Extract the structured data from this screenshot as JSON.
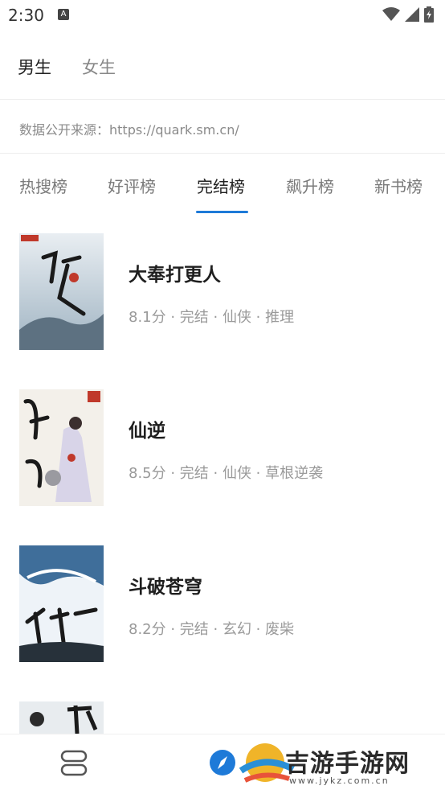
{
  "status": {
    "time": "2:30",
    "notif": "A"
  },
  "gender_tabs": [
    {
      "label": "男生",
      "active": true
    },
    {
      "label": "女生",
      "active": false
    }
  ],
  "source_text": "数据公开来源：https://quark.sm.cn/",
  "rank_tabs": [
    {
      "label": "热搜榜",
      "active": false
    },
    {
      "label": "好评榜",
      "active": false
    },
    {
      "label": "完结榜",
      "active": true
    },
    {
      "label": "飙升榜",
      "active": false
    },
    {
      "label": "新书榜",
      "active": false
    }
  ],
  "books": [
    {
      "title": "大奉打更人",
      "meta": "8.1分 · 完结 · 仙侠 · 推理",
      "cover_text": "打更人"
    },
    {
      "title": "仙逆",
      "meta": "8.5分 · 完结 · 仙侠 · 草根逆袭",
      "cover_text": "仙逆"
    },
    {
      "title": "斗破苍穹",
      "meta": "8.2分 · 完结 · 玄幻 · 废柴",
      "cover_text": "斗破苍穹"
    }
  ],
  "watermark": {
    "text": "吉游手游网",
    "sub": "www.jykz.com.cn"
  },
  "colors": {
    "accent": "#1e7ad8"
  }
}
